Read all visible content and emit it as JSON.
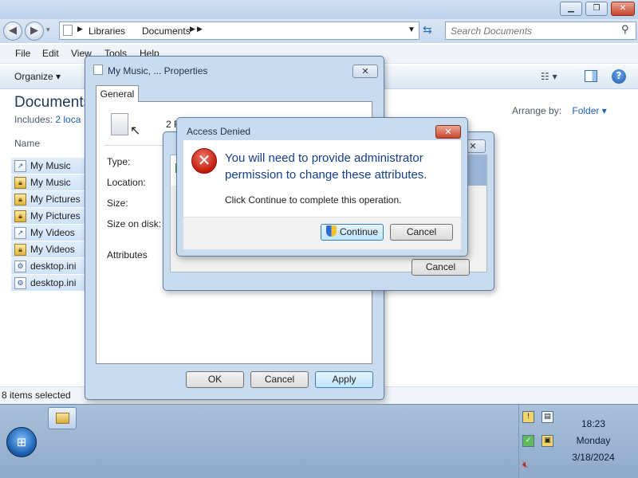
{
  "explorer": {
    "breadcrumb": [
      "Libraries",
      "Documents"
    ],
    "search_placeholder": "Search Documents",
    "menu": [
      "File",
      "Edit",
      "View",
      "Tools",
      "Help"
    ],
    "organize_label": "Organize",
    "library_title": "Documents",
    "includes_label": "Includes:",
    "includes_link": "2 loca",
    "arrange_label": "Arrange by:",
    "arrange_value": "Folder",
    "column_name": "Name",
    "files": [
      {
        "name": "My Music",
        "icon": "shortcut-icon"
      },
      {
        "name": "My Music",
        "icon": "lock-icon"
      },
      {
        "name": "My Pictures",
        "icon": "lock-icon"
      },
      {
        "name": "My Pictures",
        "icon": "lock-icon"
      },
      {
        "name": "My Videos",
        "icon": "shortcut-icon"
      },
      {
        "name": "My Videos",
        "icon": "lock-icon"
      },
      {
        "name": "desktop.ini",
        "icon": "settings-file-icon"
      },
      {
        "name": "desktop.ini",
        "icon": "settings-file-icon"
      }
    ],
    "status": "8 items selected"
  },
  "properties": {
    "title": "My Music, ... Properties",
    "tab": "General",
    "count_text": "2 F",
    "labels": {
      "type": "Type:",
      "location": "Location:",
      "size": "Size:",
      "size_on_disk": "Size on disk:",
      "attributes": "Attributes"
    },
    "ok": "OK",
    "cancel": "Cancel",
    "apply": "Apply"
  },
  "middle_dialog": {
    "cancel": "Cancel"
  },
  "access_denied": {
    "title": "Access Denied",
    "message": "You will need to provide administrator permission to change these attributes.",
    "sub_message": "Click Continue to complete this operation.",
    "continue": "Continue",
    "cancel": "Cancel"
  },
  "taskbar": {
    "clock_time": "18:23",
    "clock_day": "Monday",
    "clock_date": "3/18/2024"
  },
  "colors": {
    "accent": "#1a5fb4",
    "error_red": "#c31b0c",
    "title_blue": "#163e8a"
  }
}
